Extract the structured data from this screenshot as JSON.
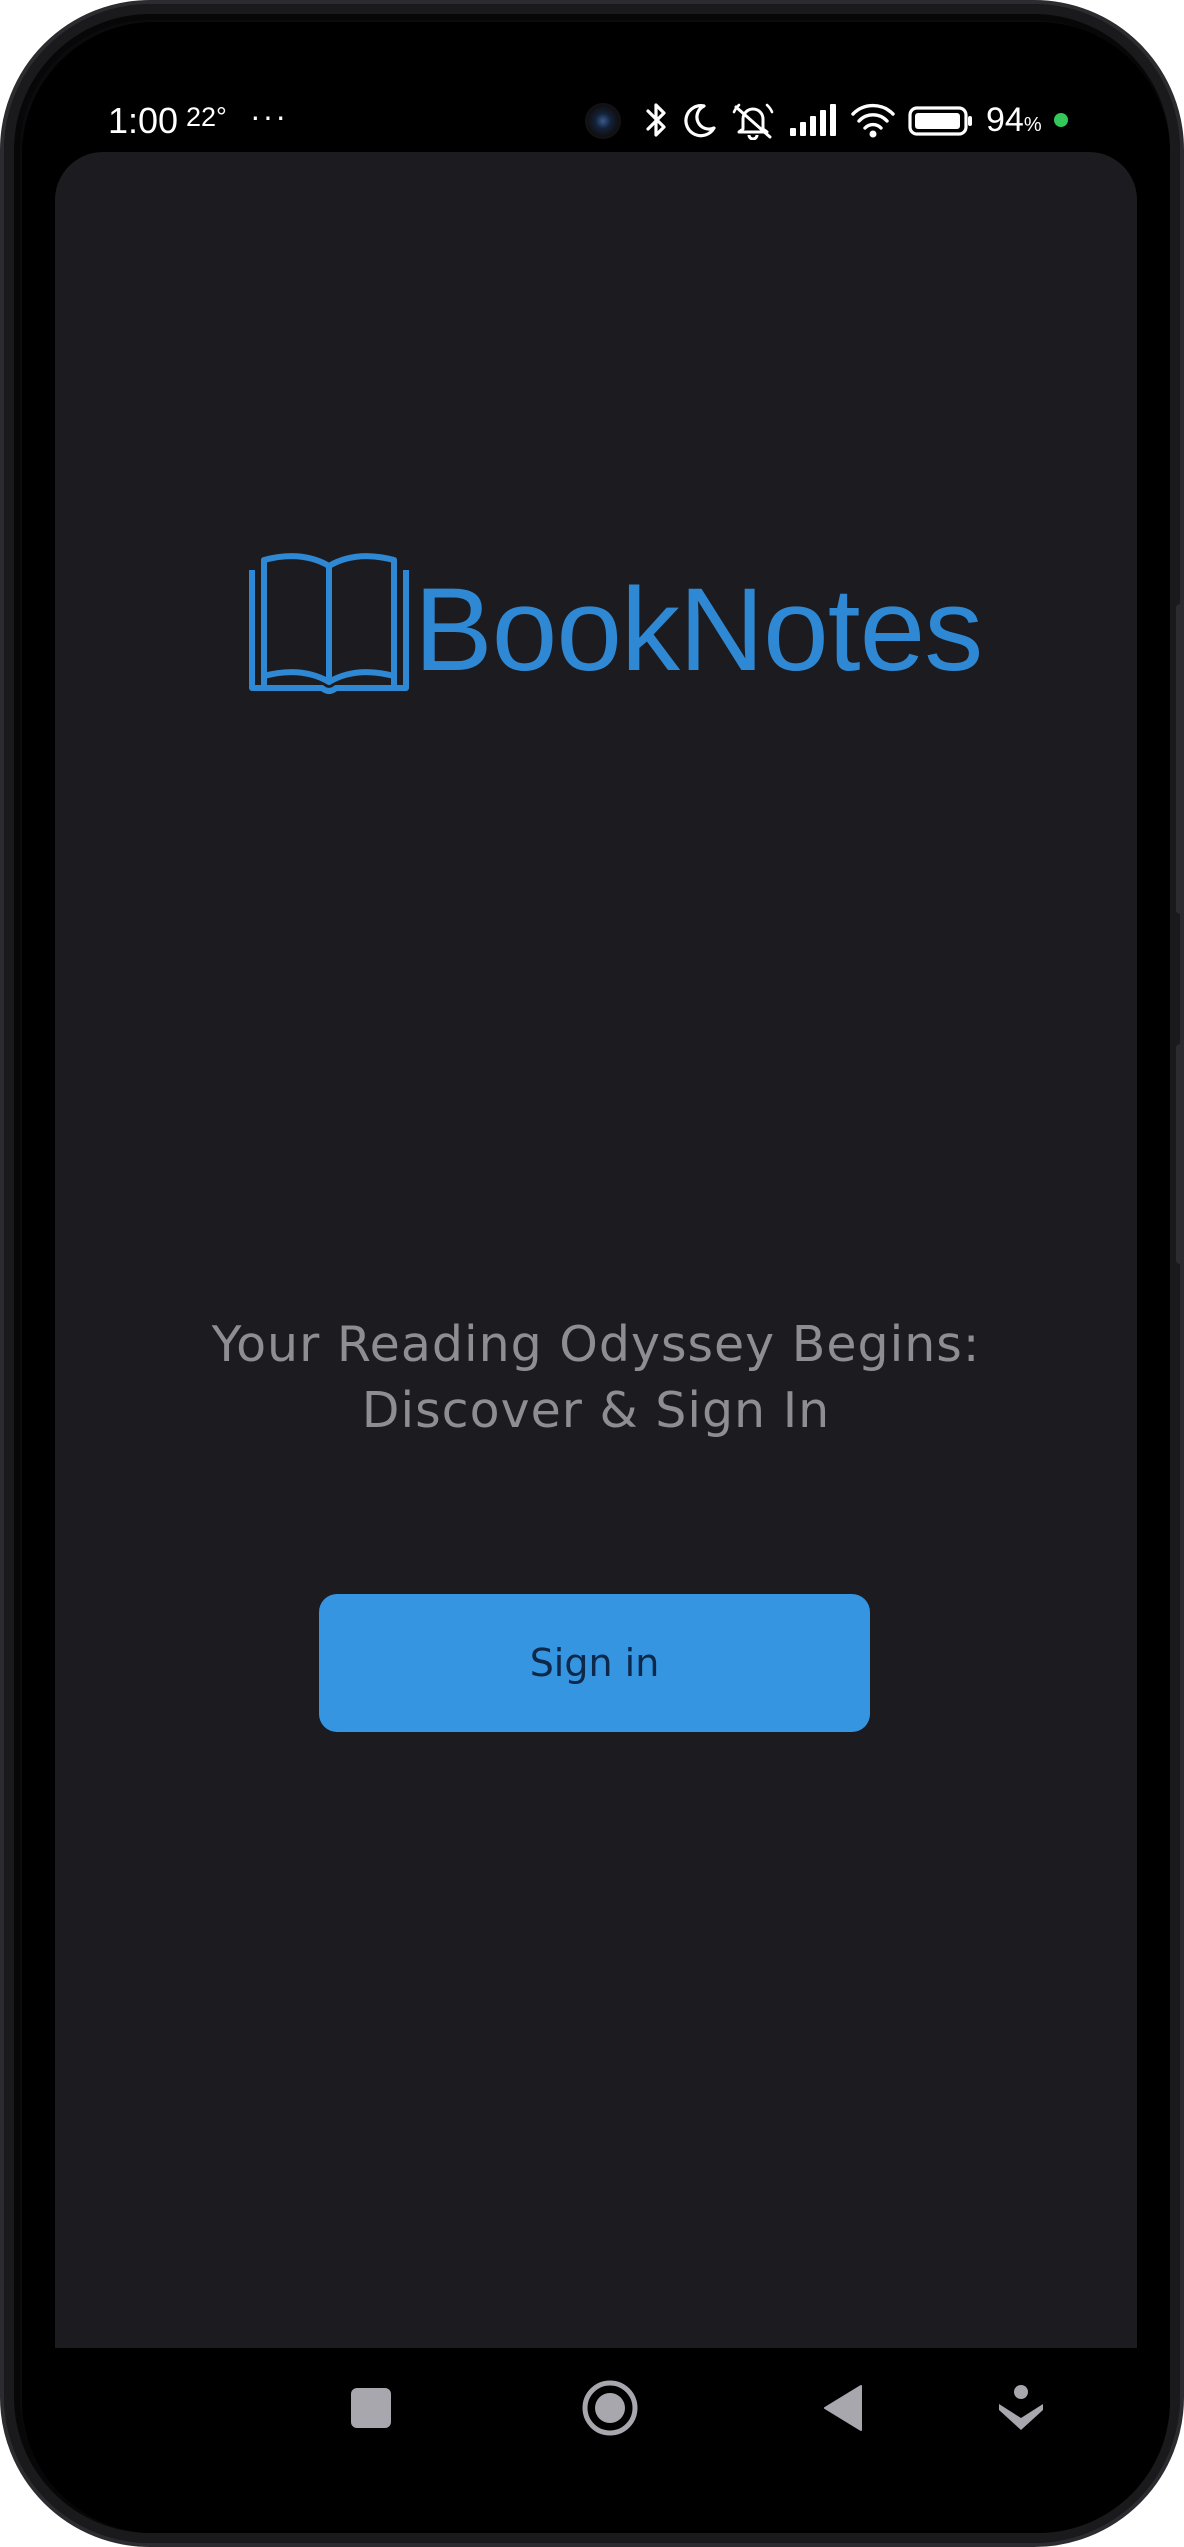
{
  "status_bar": {
    "time": "1:00",
    "temperature": "22°",
    "overflow": "···",
    "battery_percent": "94",
    "battery_percent_sign": "%",
    "icons": [
      "bluetooth-icon",
      "moon-icon",
      "silent-bell-icon",
      "signal-icon",
      "wifi-icon",
      "battery-icon"
    ]
  },
  "app": {
    "logo_text": "BookNotes",
    "tagline_line1": "Your Reading Odyssey Begins:",
    "tagline_line2": "Discover & Sign In",
    "signin_label": "Sign in"
  },
  "nav_bar": {
    "buttons": [
      "recents-icon",
      "home-icon",
      "back-icon",
      "assistant-icon"
    ]
  },
  "colors": {
    "brand": "#2f88d4",
    "button": "#3595e0",
    "button_text": "#0d2848",
    "background": "#1c1c20",
    "tagline": "#8e8e92"
  }
}
